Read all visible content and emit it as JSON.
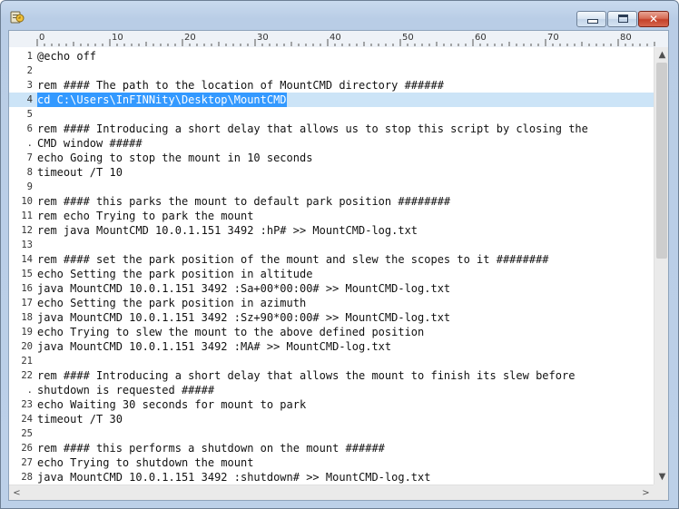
{
  "window": {
    "title": "",
    "buttons": {
      "minimize_glyph": "—",
      "maximize_glyph": "□",
      "close_glyph": "✕"
    }
  },
  "ruler": {
    "labels": [
      "0",
      "10",
      "20",
      "30",
      "40",
      "50",
      "60",
      "70",
      "80"
    ]
  },
  "editor": {
    "selected_line": 4,
    "lines": [
      {
        "num": "1",
        "text": "@echo off"
      },
      {
        "num": "2",
        "text": ""
      },
      {
        "num": "3",
        "text": "rem #### The path to the location of MountCMD directory ######"
      },
      {
        "num": "4",
        "text": "cd C:\\Users\\InFINNity\\Desktop\\MountCMD"
      },
      {
        "num": "5",
        "text": ""
      },
      {
        "num": "6",
        "text": "rem #### Introducing a short delay that allows us to stop this script by closing the"
      },
      {
        "num": ".",
        "text": "CMD window #####"
      },
      {
        "num": "7",
        "text": "echo Going to stop the mount in 10 seconds"
      },
      {
        "num": "8",
        "text": "timeout /T 10"
      },
      {
        "num": "9",
        "text": ""
      },
      {
        "num": "10",
        "text": "rem #### this parks the mount to default park position ########"
      },
      {
        "num": "11",
        "text": "rem echo Trying to park the mount"
      },
      {
        "num": "12",
        "text": "rem java MountCMD 10.0.1.151 3492 :hP# >> MountCMD-log.txt"
      },
      {
        "num": "13",
        "text": ""
      },
      {
        "num": "14",
        "text": "rem #### set the park position of the mount and slew the scopes to it ########"
      },
      {
        "num": "15",
        "text": "echo Setting the park position in altitude"
      },
      {
        "num": "16",
        "text": "java MountCMD 10.0.1.151 3492 :Sa+00*00:00# >> MountCMD-log.txt"
      },
      {
        "num": "17",
        "text": "echo Setting the park position in azimuth"
      },
      {
        "num": "18",
        "text": "java MountCMD 10.0.1.151 3492 :Sz+90*00:00# >> MountCMD-log.txt"
      },
      {
        "num": "19",
        "text": "echo Trying to slew the mount to the above defined position"
      },
      {
        "num": "20",
        "text": "java MountCMD 10.0.1.151 3492 :MA# >> MountCMD-log.txt"
      },
      {
        "num": "21",
        "text": ""
      },
      {
        "num": "22",
        "text": "rem #### Introducing a short delay that allows the mount to finish its slew before"
      },
      {
        "num": ".",
        "text": "shutdown is requested #####"
      },
      {
        "num": "23",
        "text": "echo Waiting 30 seconds for mount to park"
      },
      {
        "num": "24",
        "text": "timeout /T 30"
      },
      {
        "num": "25",
        "text": ""
      },
      {
        "num": "26",
        "text": "rem #### this performs a shutdown on the mount ######"
      },
      {
        "num": "27",
        "text": "echo Trying to shutdown the mount"
      },
      {
        "num": "28",
        "text": "java MountCMD 10.0.1.151 3492 :shutdown# >> MountCMD-log.txt"
      }
    ]
  },
  "scrollbars": {
    "up_glyph": "▲",
    "down_glyph": "▼",
    "left_glyph": "<",
    "right_glyph": ">"
  }
}
